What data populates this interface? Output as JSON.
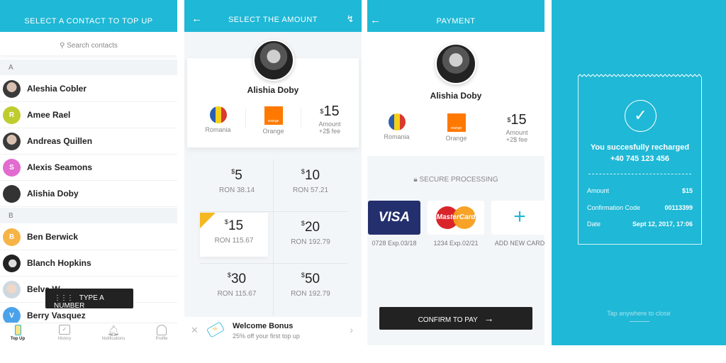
{
  "colors": {
    "accent": "#1fb8d6",
    "dark": "#222222",
    "badge": "#f5b822"
  },
  "contacts_screen": {
    "title": "SELECT A CONTACT TO TOP UP",
    "search_placeholder": "Search contacts",
    "sections": [
      {
        "letter": "A",
        "contacts": [
          {
            "name": "Aleshia Cobler",
            "initial": "",
            "color": ""
          },
          {
            "name": "Amee Rael",
            "initial": "R",
            "color": "#bfcc2e"
          },
          {
            "name": "Andreas Quillen",
            "initial": "",
            "color": ""
          },
          {
            "name": "Alexis Seamons",
            "initial": "S",
            "color": "#e26bd0"
          },
          {
            "name": "Alishia Doby",
            "initial": "",
            "color": ""
          }
        ]
      },
      {
        "letter": "B",
        "contacts": [
          {
            "name": "Ben Berwick",
            "initial": "B",
            "color": "#f6b447"
          },
          {
            "name": "Blanch Hopkins",
            "initial": "",
            "color": ""
          },
          {
            "name": "Belva W",
            "initial": "",
            "color": ""
          },
          {
            "name": "Berry Vasquez",
            "initial": "V",
            "color": "#4aa3ea"
          }
        ]
      }
    ],
    "type_number_label": "TYPE A NUMBER",
    "nav": [
      {
        "label": "Top Up",
        "icon": "phone-topup-icon"
      },
      {
        "label": "History",
        "icon": "calendar-icon"
      },
      {
        "label": "Notifications",
        "icon": "bell-icon"
      },
      {
        "label": "Profile",
        "icon": "user-icon"
      }
    ]
  },
  "amount_screen": {
    "title": "SELECT THE AMOUNT",
    "contact_name": "Alishia Doby",
    "country": "Romania",
    "operator": "Orange",
    "operator_logo_text": "orange",
    "amount_currency": "$",
    "amount": "15",
    "amount_label": "Amount",
    "fee": "+2$ fee",
    "options": [
      {
        "value": "5",
        "ron": "RON 38.14"
      },
      {
        "value": "10",
        "ron": "RON 57.21"
      },
      {
        "value": "15",
        "ron": "RON 115.67",
        "selected": true
      },
      {
        "value": "20",
        "ron": "RON 192.79"
      },
      {
        "value": "30",
        "ron": "RON 115.67"
      },
      {
        "value": "50",
        "ron": "RON 192.79"
      }
    ],
    "bonus_title": "Welcome Bonus",
    "bonus_text": "25% off your first top up"
  },
  "payment_screen": {
    "title": "PAYMENT",
    "contact_name": "Alishia Doby",
    "country": "Romania",
    "operator": "Orange",
    "amount": "15",
    "amount_label": "Amount",
    "fee": "+2$ fee",
    "secure_label": "SECURE PROCESSING",
    "cards": [
      {
        "brand": "VISA",
        "label": "0728 Exp.03/18"
      },
      {
        "brand": "MasterCard",
        "label": "1234 Exp.02/21"
      }
    ],
    "add_card_label": "ADD NEW CARD",
    "confirm_label": "CONFIRM TO PAY"
  },
  "success_screen": {
    "message": "You succesfully recharged",
    "phone": "+40 745 123 456",
    "rows": [
      {
        "label": "Amount",
        "value": "$15"
      },
      {
        "label": "Confirmation Code",
        "value": "00113399"
      },
      {
        "label": "Date",
        "value": "Sept 12, 2017, 17:06"
      }
    ],
    "close_hint": "Tap anywhere to close"
  }
}
